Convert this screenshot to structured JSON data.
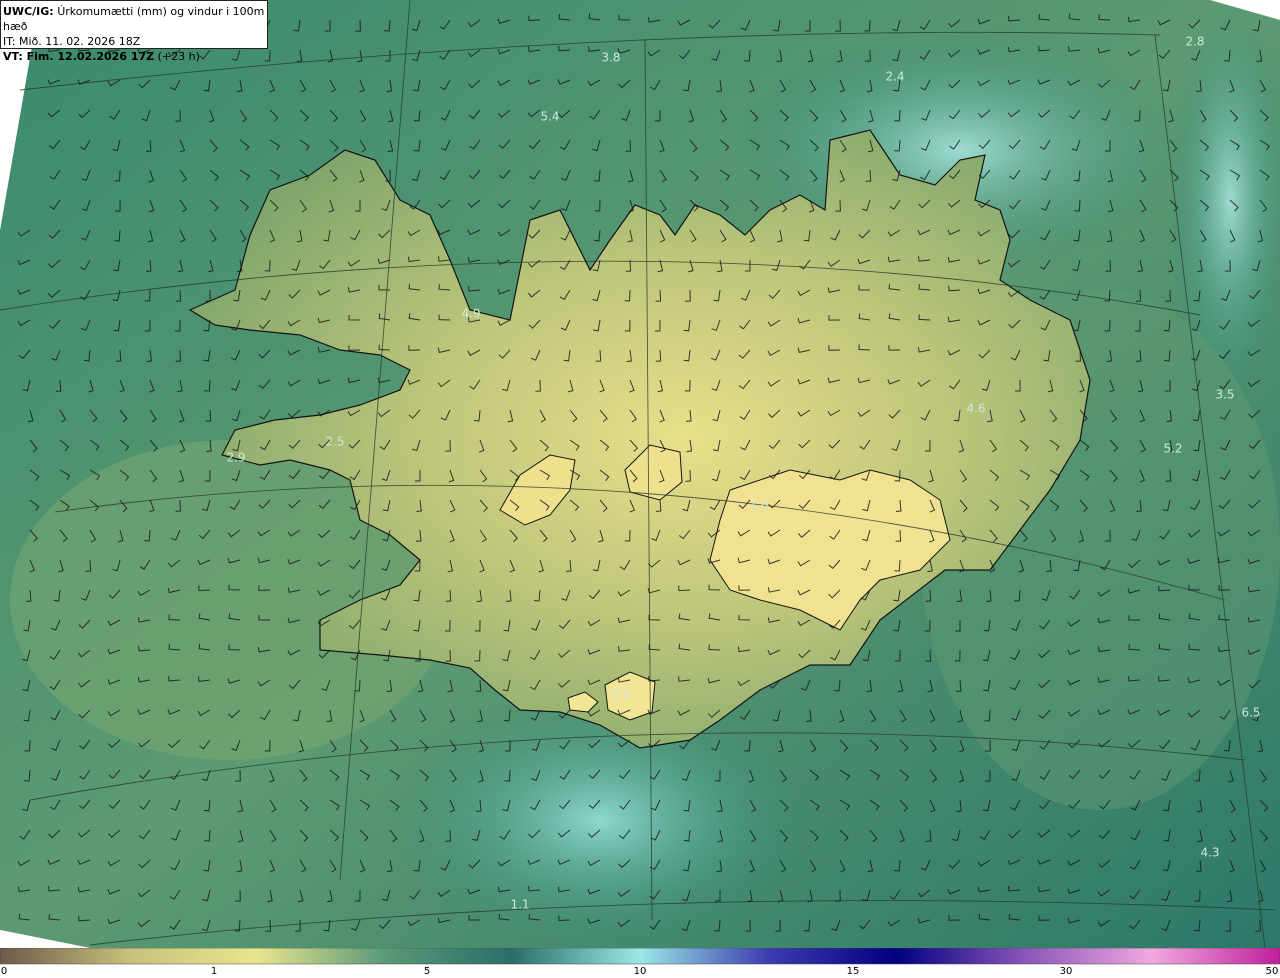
{
  "header": {
    "model_code": "UWC/IG:",
    "field_description": "Úrkomumætti (mm) og vindur i 100m hæð",
    "it_line": "IT: Mið. 11. 02. 2026 18Z",
    "vt_label": "VT: Fim. 12.02.2026 17Z",
    "vt_suffix": "(+23 h)"
  },
  "map_labels": [
    {
      "text": "3.8"
    },
    {
      "text": "5.4"
    },
    {
      "text": "2.4"
    },
    {
      "text": "2.8"
    },
    {
      "text": "4.9"
    },
    {
      "text": "4.6"
    },
    {
      "text": "3.5"
    },
    {
      "text": "5.2"
    },
    {
      "text": "2.5"
    },
    {
      "text": "2.9"
    },
    {
      "text": "1.0"
    },
    {
      "text": "6.5"
    },
    {
      "text": "4.3"
    },
    {
      "text": "3.3"
    },
    {
      "text": "1.1"
    }
  ],
  "colorbar": {
    "ticks": [
      "0",
      "1",
      "5",
      "10",
      "15",
      "30",
      "50"
    ],
    "colors": [
      "#6b5a4a",
      "#c6c07a",
      "#eae58e",
      "#5a9a78",
      "#2a6e6a",
      "#9ae8e6",
      "#3d3db0",
      "#000080",
      "#8a55b8",
      "#f0a8e0",
      "#c0209a"
    ]
  },
  "colors": {
    "sea": "#2f7a6a",
    "land": "#cccc80",
    "coastline": "#141414",
    "label": "#cfe8d8"
  }
}
